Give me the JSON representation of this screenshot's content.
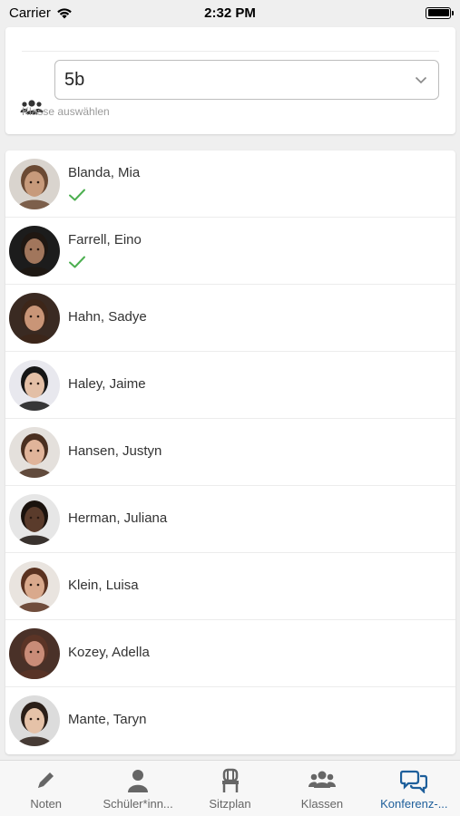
{
  "status_bar": {
    "carrier": "Carrier",
    "time": "2:32 PM"
  },
  "class_selector": {
    "selected": "5b",
    "hint": "Klasse auswählen"
  },
  "students": [
    {
      "name": "Blanda, Mia",
      "checked": true,
      "skin": "#c79a7b",
      "hair": "#6b4a34",
      "bg": "#d9d4ce"
    },
    {
      "name": "Farrell, Eino",
      "checked": true,
      "skin": "#a1765c",
      "hair": "#1f1712",
      "bg": "#1c1c1c"
    },
    {
      "name": "Hahn, Sadye",
      "checked": false,
      "skin": "#c99577",
      "hair": "#3d2619",
      "bg": "#3a2a22"
    },
    {
      "name": "Haley, Jaime",
      "checked": false,
      "skin": "#e3bfa6",
      "hair": "#161616",
      "bg": "#e8e8ee"
    },
    {
      "name": "Hansen, Justyn",
      "checked": false,
      "skin": "#e0b49a",
      "hair": "#4a2f20",
      "bg": "#e4e0dc"
    },
    {
      "name": "Herman, Juliana",
      "checked": false,
      "skin": "#5a3b2b",
      "hair": "#1a120d",
      "bg": "#e6e6e6"
    },
    {
      "name": "Klein, Luisa",
      "checked": false,
      "skin": "#d9a98c",
      "hair": "#5a3220",
      "bg": "#e9e4df"
    },
    {
      "name": "Kozey, Adella",
      "checked": false,
      "skin": "#c98c78",
      "hair": "#5b3426",
      "bg": "#4a3128"
    },
    {
      "name": "Mante, Taryn",
      "checked": false,
      "skin": "#e5c2a8",
      "hair": "#2b1f18",
      "bg": "#dcdcdc"
    }
  ],
  "tabs": [
    {
      "label": "Noten",
      "icon": "pencil-icon",
      "active": false
    },
    {
      "label": "Schüler*inn...",
      "icon": "person-icon",
      "active": false
    },
    {
      "label": "Sitzplan",
      "icon": "chair-icon",
      "active": false
    },
    {
      "label": "Klassen",
      "icon": "group-icon",
      "active": false
    },
    {
      "label": "Konferenz-...",
      "icon": "chat-bubbles-icon",
      "active": true
    }
  ],
  "colors": {
    "accent": "#1e5f9b",
    "check": "#4caf50"
  }
}
